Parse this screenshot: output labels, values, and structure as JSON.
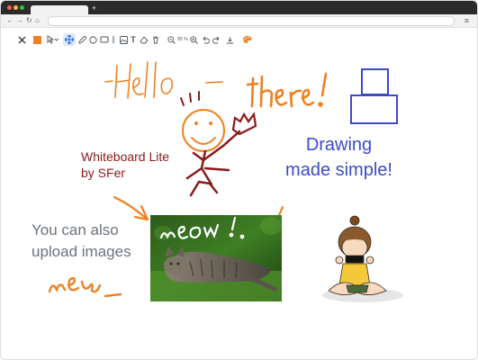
{
  "browser": {
    "colors": {
      "close": "#ff5f57",
      "minimize": "#febc2e",
      "maximize": "#28c840"
    },
    "new_tab_label": "+",
    "menu_label": "≡"
  },
  "toolbar": {
    "pen_color": "#f07f1e",
    "zoom_label": "85 %",
    "text_tool_label": "T",
    "icons": [
      "close-icon",
      "color-swatch",
      "select-icon",
      "move-icon",
      "pen-icon",
      "circle-icon",
      "rectangle-icon",
      "line-icon",
      "image-icon",
      "text-icon",
      "eraser-icon",
      "trash-icon",
      "zoom-out-icon",
      "zoom-in-icon",
      "undo-icon",
      "redo-icon",
      "download-icon",
      "palette-icon"
    ]
  },
  "canvas": {
    "handwriting": {
      "hello": "-Hello",
      "dash": "—",
      "there": "there!",
      "meow_on_photo": "meow!",
      "meow_bottom": "meow"
    },
    "title_line1": "Whiteboard Lite",
    "title_line2": "by SFer",
    "blue_line1": "Drawing",
    "blue_line2": "made simple!",
    "gray_line1": "You can also",
    "gray_line2": "upload images",
    "colors": {
      "orange": "#f07f1e",
      "maroon": "#8b1a1a",
      "blue": "#3b4bc8",
      "gray": "#6b7280"
    }
  }
}
